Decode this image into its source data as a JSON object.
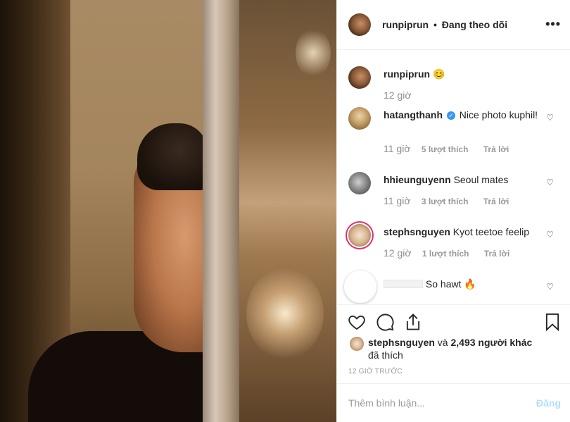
{
  "post": {
    "username": "runpiprun",
    "follow_status": "Đang theo dõi",
    "separator": "•",
    "more_icon": "more-horizontal-icon",
    "caption": {
      "username": "runpiprun",
      "text": "😊",
      "time": "12 giờ"
    }
  },
  "comments": [
    {
      "username": "hatangthanh",
      "verified": true,
      "text": "Nice photo kuphil!",
      "time": "11 giờ",
      "likes": "5 lượt thích",
      "reply": "Trả lời"
    },
    {
      "username": "hhieunguyenn",
      "verified": false,
      "text": "Seoul mates",
      "time": "11 giờ",
      "likes": "3 lượt thích",
      "reply": "Trả lời"
    },
    {
      "username": "stephsnguyen",
      "verified": false,
      "text": "Kyot teetoe feelip",
      "time": "12 giờ",
      "likes": "1 lượt thích",
      "reply": "Trả lời"
    },
    {
      "username": "",
      "verified": false,
      "text": "So hawt 🔥"
    }
  ],
  "actions": {
    "like_icon": "heart-icon",
    "comment_icon": "comment-icon",
    "share_icon": "share-icon",
    "save_icon": "bookmark-icon"
  },
  "likes": {
    "user": "stephsnguyen",
    "and": "và",
    "others": "2,493 người khác",
    "suffix": "đã thích"
  },
  "posted_ago": "12 GIỜ TRƯỚC",
  "add_comment": {
    "placeholder": "Thêm bình luận...",
    "post_label": "Đăng"
  },
  "colors": {
    "verified": "#3897f0",
    "post_disabled": "#b2dffc",
    "story_ring": "#e1306c"
  }
}
